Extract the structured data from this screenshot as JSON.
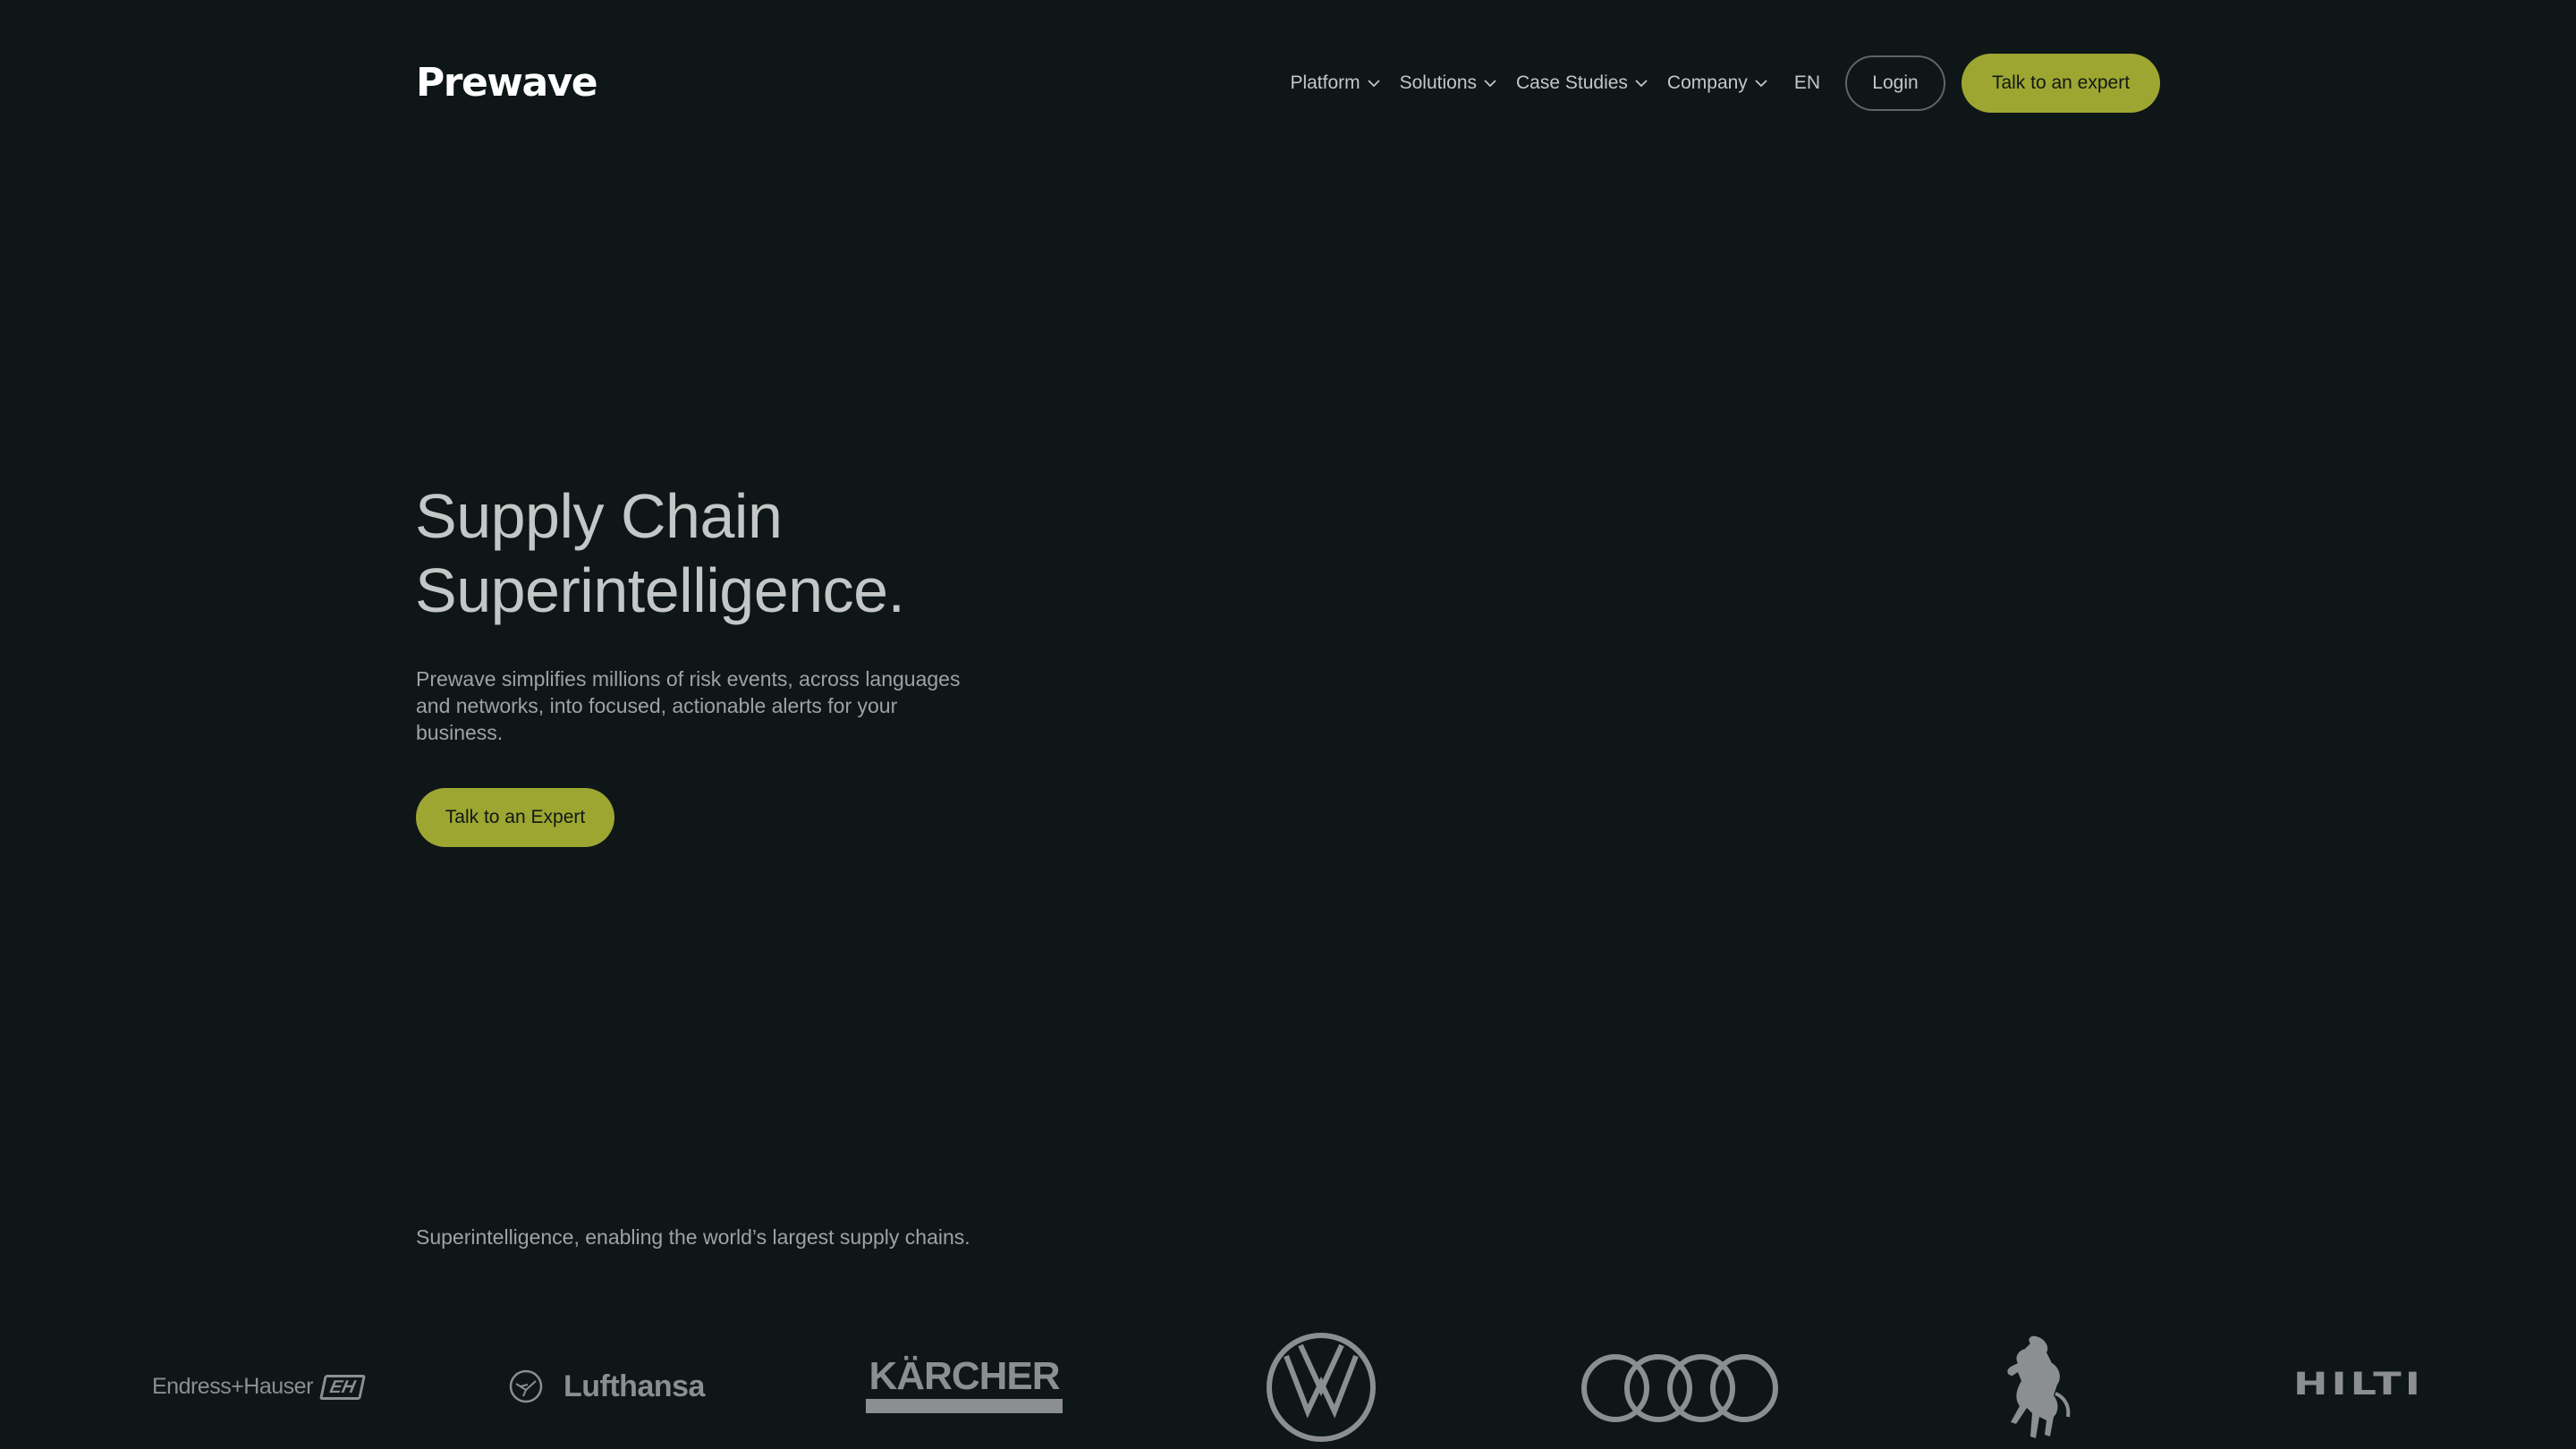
{
  "brand": {
    "name": "Prewave"
  },
  "nav": {
    "items": [
      {
        "label": "Platform",
        "icon": "chevron-down-icon"
      },
      {
        "label": "Solutions",
        "icon": "chevron-down-icon"
      },
      {
        "label": "Case Studies",
        "icon": "chevron-down-icon"
      },
      {
        "label": "Company",
        "icon": "chevron-down-icon"
      }
    ],
    "language": "EN",
    "login_label": "Login",
    "cta_label": "Talk to an expert"
  },
  "hero": {
    "title_line1": "Supply Chain",
    "title_line2": "Superintelligence.",
    "description": "Prewave simplifies millions of risk events, across languages and networks, into focused, actionable alerts for your business.",
    "cta_label": "Talk to an Expert"
  },
  "customers": {
    "caption": "Superintelligence, enabling the world’s largest supply chains.",
    "logos": [
      {
        "name": "Endress+Hauser",
        "badge": "EH"
      },
      {
        "name": "Lufthansa"
      },
      {
        "name": "KÄRCHER"
      },
      {
        "name": "Volkswagen"
      },
      {
        "name": "Audi"
      },
      {
        "name": "Ferrari"
      },
      {
        "name": "HILTI"
      }
    ]
  },
  "colors": {
    "background": "#0f1617",
    "accent": "#9da631",
    "text": "#c3c7c6",
    "muted": "#9ea3a2",
    "logo_gray": "#8b8f8f"
  }
}
